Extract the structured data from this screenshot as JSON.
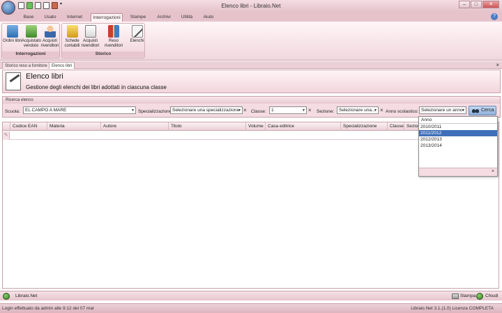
{
  "window": {
    "title": "Elenco libri - Libraio.Net",
    "minimize": "–",
    "maximize": "□",
    "close": "✕"
  },
  "ribbon": {
    "tabs": [
      "Base",
      "Usato",
      "Internet",
      "Interrogazioni",
      "Stampe",
      "Archivi",
      "Utilità",
      "Aiuto"
    ],
    "active_tab": "Interrogazioni",
    "groups": [
      {
        "label": "Interrogazioni",
        "buttons": [
          {
            "label": "Ordini libri",
            "icon": "books-icon"
          },
          {
            "label": "Acquistato venduto",
            "icon": "books-exchange-icon"
          },
          {
            "label": "Acquisti rivenditori",
            "icon": "person-icon"
          }
        ]
      },
      {
        "label": "Storico",
        "buttons": [
          {
            "label": "Schede contabili",
            "icon": "ledger-icon"
          },
          {
            "label": "Acquisti rivenditori",
            "icon": "document-icon"
          },
          {
            "label": "Reso rivenditori",
            "icon": "books-return-icon"
          },
          {
            "label": "Elenchi",
            "icon": "list-pen-icon"
          }
        ]
      }
    ]
  },
  "doc_tabs": [
    "Storico reso a fornitore",
    "Elenco libri"
  ],
  "doc_close": "×",
  "header": {
    "title": "Elenco libri",
    "subtitle": "Gestione degli elenchi dei libri adottati in ciascuna classe"
  },
  "search": {
    "section_label": "Ricerca elenco",
    "scuola_label": "Scuola:",
    "scuola_value": "EL CAMPO A MARE",
    "specializzazione_label": "Specializzazione:",
    "specializzazione_value": "Selezionare una specializzazione",
    "classe_label": "Classe:",
    "classe_value": "1",
    "sezione_label": "Sezione:",
    "sezione_value": "Selezionare una...",
    "anno_label": "Anno scolastico:",
    "anno_value": "Selezionare un anno",
    "button": "Cerca",
    "clear_glyph": "×",
    "arrow_glyph": "▾"
  },
  "table": {
    "columns": [
      "Codice EAN",
      "Materia",
      "Autore",
      "Titolo",
      "Volume",
      "Casa editrice",
      "Specializzazione",
      "Classe",
      "Sezione"
    ],
    "new_row_marker": "✎"
  },
  "anno_dropdown": {
    "header": "Anno",
    "options": [
      "2010/2011",
      "2011/2012",
      "2012/2013",
      "2013/2014"
    ],
    "highlighted": "2011/2012",
    "close": "×"
  },
  "bottom_bar": {
    "app_label": "Libraio.Net",
    "print_label": "Stampa",
    "close_label": "Chiudi"
  },
  "status_bar": {
    "left": "Login effettuato da admin alle 9:12 del 07 mar",
    "right": "Libraio.Net 3.1.(1.0) Licenza COMPLETA"
  }
}
